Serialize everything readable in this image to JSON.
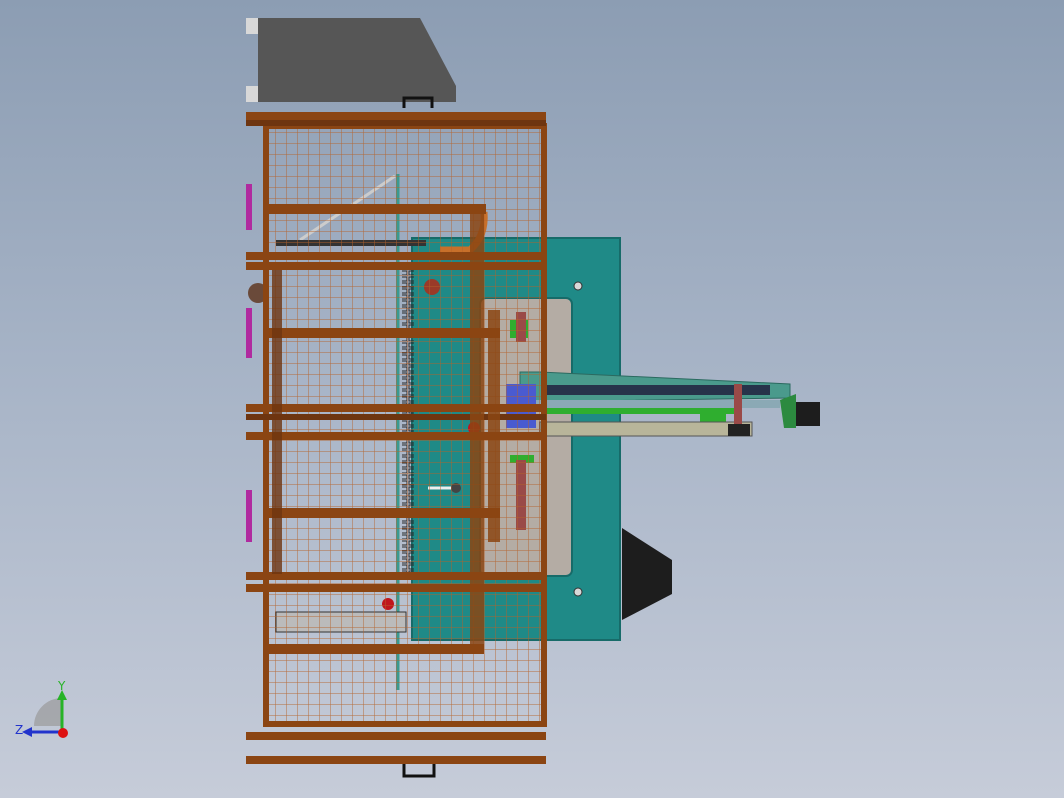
{
  "view": {
    "type": "cad-3d-viewport",
    "background_top": "#8c9db3",
    "background_bottom": "#c6ccd9"
  },
  "colors": {
    "frame": "#8b4513",
    "frame_dark": "#6e3510",
    "mesh": "#b5622a",
    "panel": "#1f8a87",
    "panel_dark": "#176b69",
    "inner_panel": "#b4aca4",
    "hopper": "#555555",
    "motor": "#1d1d1d",
    "arm": "#4a9a8c",
    "accent_magenta": "#b02a9f",
    "accent_red": "#c0161c",
    "accent_green": "#2fae2f",
    "accent_blue": "#4a5bd0"
  },
  "triad": {
    "y_label": "Y",
    "z_label": "Z",
    "y_color": "#27b327",
    "z_color": "#2233cc",
    "x_color": "#dd1111"
  }
}
